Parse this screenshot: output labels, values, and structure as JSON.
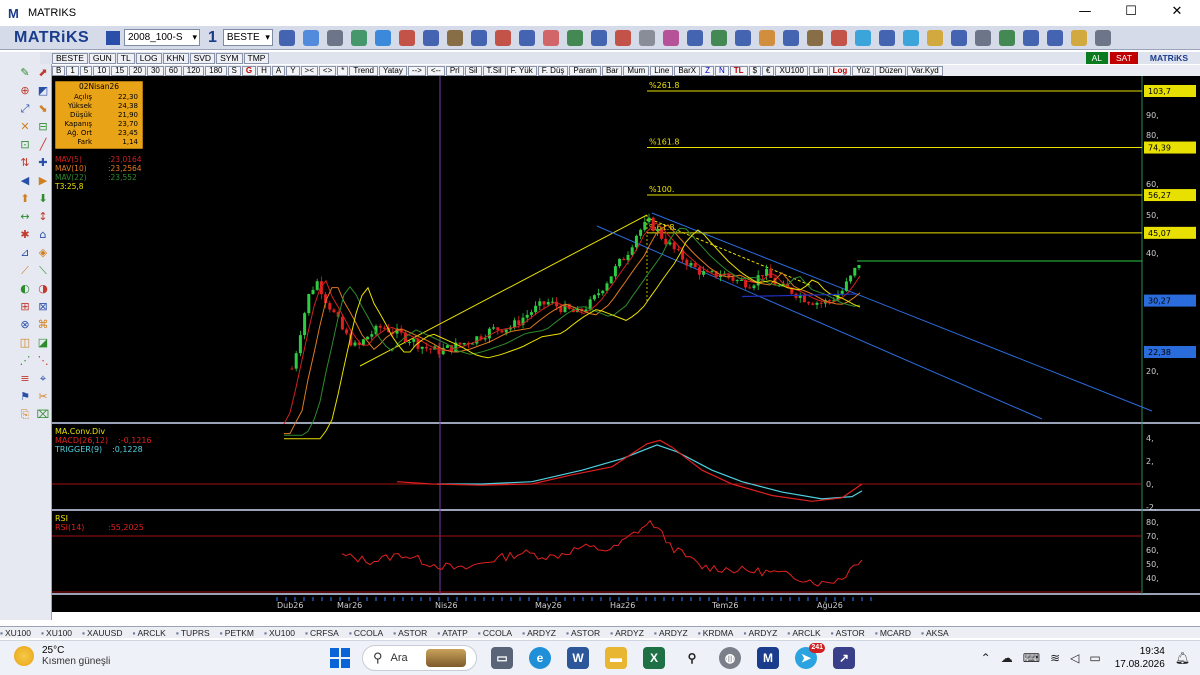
{
  "window": {
    "title": "MATRIKS",
    "minimize": "—",
    "maximize": "☐",
    "close": "✕"
  },
  "toolbar": {
    "brand": "MATRiKS",
    "layout_combo": "2008_100-S",
    "period_digit": "1",
    "symbol_combo": "BESTE",
    "tool_icons": [
      "save-icon",
      "calendar-icon",
      "print-icon",
      "globe-icon",
      "gauge-icon",
      "history-icon",
      "handshake-icon",
      "clipboard-icon",
      "bold-b-icon",
      "font-a-icon",
      "currency-u-icon",
      "chain-icon",
      "grid-icon",
      "news-icon",
      "mail-icon",
      "chart-icon",
      "fx-icon",
      "table-icon",
      "chart2-icon",
      "lock-icon",
      "thumb-icon",
      "building-icon",
      "folder-icon",
      "flag-icon",
      "twitter-icon",
      "refresh-icon",
      "telegram-icon",
      "key-icon",
      "grid2-icon",
      "calc-icon",
      "chart3-icon",
      "bell-icon",
      "download-icon",
      "star-icon",
      "settings-icon"
    ]
  },
  "chart_header": {
    "cells": [
      "BESTE",
      "GUN",
      "TL",
      "LOG",
      "KHN",
      "SVD",
      "SYM",
      "TMP"
    ],
    "al": "AL",
    "sat": "SAT",
    "brand": "MATRiKS"
  },
  "period_bar": {
    "left": [
      "B",
      "1",
      "5",
      "10",
      "15",
      "20",
      "30",
      "60",
      "120",
      "180",
      "S",
      "G",
      "H",
      "A",
      "Y",
      "><",
      "<>",
      "*"
    ],
    "tools": [
      "Trend",
      "Yatay",
      "-->",
      "<--",
      "Prl",
      "Sil",
      "T.Sil",
      "F. Yük",
      "F. Düş",
      "Param",
      "Bar",
      "Mum",
      "Line",
      "BarX",
      "Z",
      "N",
      "TL",
      "$",
      "€",
      "XU100",
      "Lin",
      "Log",
      "Yüz",
      "Düzen",
      "Var.Kyd"
    ]
  },
  "ohlc_box": {
    "date": "02Nisan26",
    "rows": [
      {
        "label": "Açılış",
        "value": "22,30"
      },
      {
        "label": "Yüksek",
        "value": "24,38"
      },
      {
        "label": "Düşük",
        "value": "21,90"
      },
      {
        "label": "Kapanış",
        "value": "23,70"
      },
      {
        "label": "Ağ. Ort",
        "value": "23,45"
      },
      {
        "label": "Fark",
        "value": "1,14"
      }
    ]
  },
  "ma_legend": [
    {
      "label": "MAV(5)",
      "value": ":23,0164",
      "color": "#d22020"
    },
    {
      "label": "MAV(10)",
      "value": ":23,2564",
      "color": "#e07a20"
    },
    {
      "label": "MAV(22)",
      "value": ":23,552",
      "color": "#2e8b2e"
    },
    {
      "label": "T3:25,8",
      "value": "",
      "color": "#e8e000"
    }
  ],
  "fib_levels": [
    {
      "label": "%261.8",
      "value": "103,7"
    },
    {
      "label": "%161.8",
      "value": "74,39"
    },
    {
      "label": "%100.",
      "value": "56,27"
    },
    {
      "label": "%61.8",
      "value": "45,07"
    }
  ],
  "price_markers": [
    {
      "value": "30,27",
      "color": "#2a6cdc"
    },
    {
      "value": "22,38",
      "color": "#2a6cdc"
    }
  ],
  "price_axis_ticks": [
    "90,",
    "80,",
    "60,",
    "50,",
    "40,",
    "20,"
  ],
  "macd_panel": {
    "title": "MA.Conv.Div",
    "macd_label": "MACD(26,12)",
    "macd_value": ":-0,1216",
    "trigger_label": "TRIGGER(9)",
    "trigger_value": ":0,1228",
    "ticks": [
      "4,",
      "2,",
      "0,",
      "-2,"
    ]
  },
  "rsi_panel": {
    "title": "RSI",
    "label": "RSI(14)",
    "value": ":55,2025",
    "ticks": [
      "80,",
      "70,",
      "60,",
      "50,",
      "40,"
    ]
  },
  "time_axis": [
    "Dub26",
    "Mar26",
    "Nis26",
    "May26",
    "Haz26",
    "Tem26",
    "Ağu26"
  ],
  "chart_data": {
    "type": "candlestick",
    "symbol": "BESTE",
    "x": [
      "Dub26",
      "Mar26",
      "Nis26",
      "May26",
      "Haz26",
      "Tem26",
      "Ağu26"
    ],
    "close_estimates": [
      14,
      24,
      23,
      30,
      46,
      34,
      38
    ],
    "fibonacci": {
      "%261.8": 103.7,
      "%161.8": 74.39,
      "%100.": 56.27,
      "%61.8": 45.07
    },
    "markers": [
      30.27,
      22.38
    ],
    "scale": "log",
    "macd": {
      "MACD(26,12)": -0.1216,
      "TRIGGER(9)": 0.1228
    },
    "rsi": {
      "RSI(14)": 55.2025
    }
  },
  "symbol_tabs": [
    "XU100",
    "XU100",
    "XAUUSD",
    "ARCLK",
    "TUPRS",
    "PETKM",
    "XU100",
    "CRFSA",
    "CCOLA",
    "ASTOR",
    "ATATP",
    "CCOLA",
    "ARDYZ",
    "ASTOR",
    "ARDYZ",
    "ARDYZ",
    "KRDMA",
    "ARDYZ",
    "ARCLK",
    "ASTOR",
    "MCARD",
    "AKSA"
  ],
  "taskbar": {
    "temperature": "25°C",
    "weather_desc": "Kısmen güneşli",
    "search_placeholder": "Ara",
    "telegram_badge": "241",
    "time": "19:34",
    "date": "17.08.2026"
  }
}
